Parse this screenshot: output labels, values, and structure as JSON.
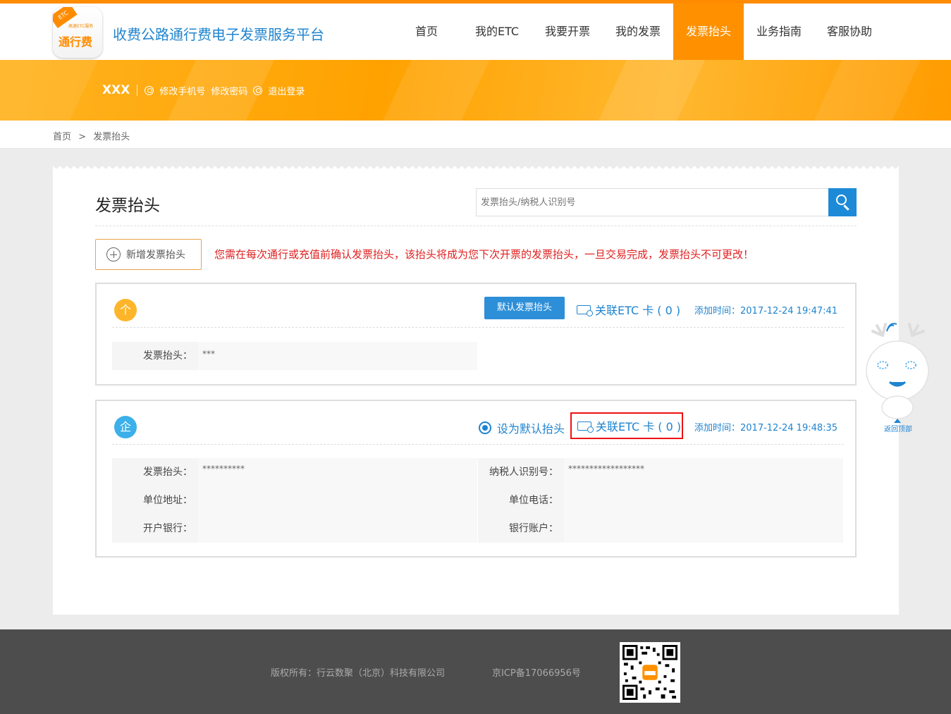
{
  "header": {
    "logo_badge": "ETC",
    "logo_small": "高速ETC服务",
    "logo_text": "通行费",
    "site_title": "收费公路通行费电子发票服务平台",
    "nav": [
      "首页",
      "我的ETC",
      "我要开票",
      "我的发票",
      "发票抬头",
      "业务指南",
      "客服协助"
    ],
    "active_nav": "发票抬头"
  },
  "userbar": {
    "username": "XXX",
    "links": [
      "修改手机号",
      "修改密码",
      "退出登录"
    ]
  },
  "breadcrumb": {
    "home": "首页",
    "separator": ">",
    "current": "发票抬头"
  },
  "main": {
    "title": "发票抬头",
    "search_placeholder": "发票抬头/纳税人识别号",
    "add_button": "新增发票抬头",
    "warning": "您需在每次通行或充值前确认发票抬头，该抬头将成为您下次开票的发票抬头，一旦交易完成，发票抬头不可更改！",
    "cards": [
      {
        "type_badge": "个",
        "default_button": "默认发票抬头",
        "link_etc": "关联ETC 卡 ( 0 )",
        "added_time": "添加时间：2017-12-24 19:47:41",
        "fields": [
          {
            "label": "发票抬头：",
            "value": "***"
          }
        ]
      },
      {
        "type_badge": "企",
        "set_default": "设为默认抬头",
        "link_etc": "关联ETC 卡 ( 0 )",
        "added_time": "添加时间：2017-12-24 19:48:35",
        "left_fields": [
          {
            "label": "发票抬头：",
            "value": "**********"
          },
          {
            "label": "单位地址：",
            "value": ""
          },
          {
            "label": "开户银行：",
            "value": ""
          }
        ],
        "right_fields": [
          {
            "label": "纳税人识别号：",
            "value": "******************"
          },
          {
            "label": "单位电话：",
            "value": ""
          },
          {
            "label": "银行账户：",
            "value": ""
          }
        ]
      }
    ]
  },
  "side": {
    "back_to_top": "返回顶部"
  },
  "footer": {
    "copyright": "版权所有：行云数聚（北京）科技有限公司",
    "icp": "京ICP备17066956号"
  },
  "colors": {
    "brand_orange": "#ff9100",
    "link_blue": "#1f84cf",
    "warning_red": "#e02020",
    "highlight_red": "#ee1111"
  }
}
